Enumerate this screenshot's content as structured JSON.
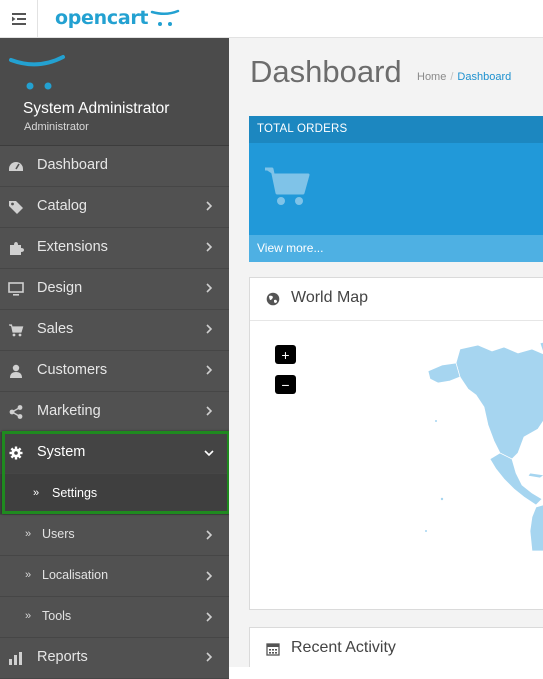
{
  "header": {
    "brand": "opencart",
    "menu_icon": "hamburger-indent-icon"
  },
  "sidebar": {
    "profile": {
      "name": "System Administrator",
      "role": "Administrator"
    },
    "items": [
      {
        "label": "Dashboard",
        "icon": "dashboard-icon"
      },
      {
        "label": "Catalog",
        "icon": "tags-icon"
      },
      {
        "label": "Extensions",
        "icon": "puzzle-icon"
      },
      {
        "label": "Design",
        "icon": "monitor-icon"
      },
      {
        "label": "Sales",
        "icon": "cart-icon"
      },
      {
        "label": "Customers",
        "icon": "user-icon"
      },
      {
        "label": "Marketing",
        "icon": "share-icon"
      },
      {
        "label": "System",
        "icon": "cog-icon"
      }
    ],
    "system_sub": [
      {
        "label": "Settings"
      },
      {
        "label": "Users"
      },
      {
        "label": "Localisation"
      },
      {
        "label": "Tools"
      }
    ],
    "reports": {
      "label": "Reports",
      "icon": "bar-chart-icon"
    }
  },
  "main": {
    "title": "Dashboard",
    "breadcrumb": [
      {
        "label": "Home"
      },
      {
        "label": "Dashboard"
      }
    ],
    "tile": {
      "heading": "TOTAL ORDERS",
      "footer": "View more..."
    },
    "world_map": {
      "title": "World Map",
      "zoom_in": "+",
      "zoom_out": "−"
    },
    "recent_activity": {
      "title": "Recent Activity"
    }
  },
  "colors": {
    "brand": "#23a1d1",
    "sidebar_bg": "#515151",
    "tile_bg": "#1e91cf",
    "highlight": "#1f8a1f",
    "map_land": "#a6d5f0"
  }
}
